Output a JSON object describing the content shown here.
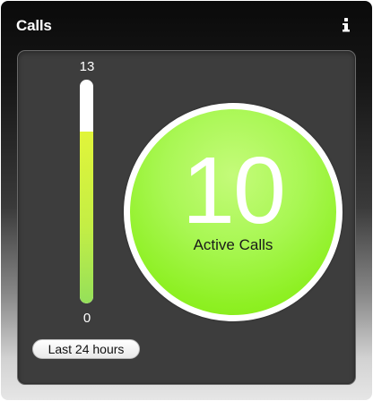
{
  "widget": {
    "title": "Calls",
    "info_icon": "info-icon"
  },
  "gauge": {
    "max_label": "13",
    "min_label": "0",
    "max": 13,
    "min": 0,
    "value": 10,
    "fill_color": "#c4ee45"
  },
  "time_range": {
    "label": "Last 24 hours"
  },
  "active_calls": {
    "count": "10",
    "label": "Active Calls",
    "circle_color": "#8ef023"
  }
}
